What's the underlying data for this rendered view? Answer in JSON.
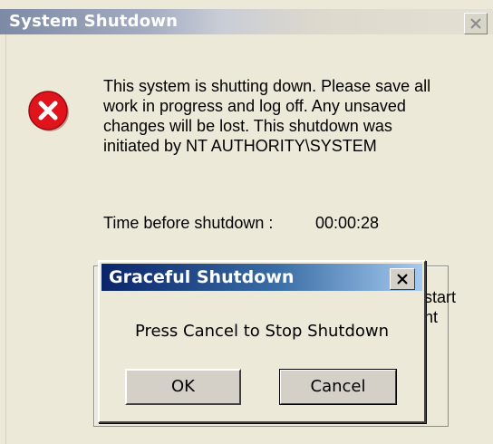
{
  "system_window": {
    "title": "System Shutdown",
    "message": "This system is shutting down. Please save all\nwork in progress and log off. Any unsaved\nchanges will be lost. This shutdown was\ninitiated by NT AUTHORITY\\SYSTEM",
    "time_label": "Time before shutdown :",
    "time_value": "00:00:28",
    "obscured_text_line1": "start",
    "obscured_text_line2": "ht",
    "icons": {
      "close": "close-icon",
      "error": "error-icon"
    }
  },
  "graceful_dialog": {
    "title": "Graceful Shutdown",
    "message": "Press Cancel to Stop Shutdown",
    "ok_label": "OK",
    "cancel_label": "Cancel",
    "icons": {
      "close": "close-icon"
    }
  },
  "colors": {
    "dialog_title_start": "#0a246a",
    "dialog_title_end": "#a6caf0",
    "window_background": "#ece9d8",
    "error_red": "#e0141c"
  }
}
